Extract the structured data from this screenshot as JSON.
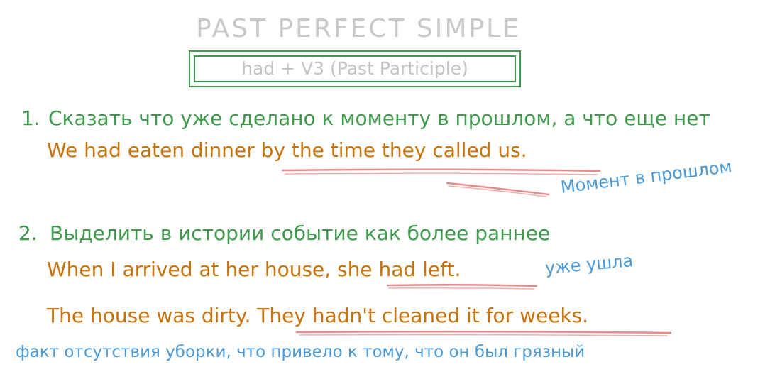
{
  "title": "PAST PERFECT SIMPLE",
  "formula": "had + V3 (Past Participle)",
  "sections": [
    {
      "number": "1.",
      "heading": "Сказать что уже сделано к моменту в прошлом, а что еще нет",
      "examples": [
        {
          "text": "We had eaten dinner by the time they called us."
        }
      ],
      "note": "Момент в прошлом"
    },
    {
      "number": "2.",
      "heading": "Выделить в истории событие как более раннее",
      "examples": [
        {
          "text": "When I arrived at her house, she had left.",
          "note": "уже ушла"
        },
        {
          "text": "The house was dirty. They hadn't cleaned it for weeks."
        }
      ],
      "note": "факт отсутствия уборки, что привело к тому, что он был грязный"
    }
  ],
  "colors": {
    "heading": "#3d9b4b",
    "example": "#c8730a",
    "note": "#4a9ad8",
    "underline": "#e98b8b",
    "title": "#c9c9c9"
  }
}
